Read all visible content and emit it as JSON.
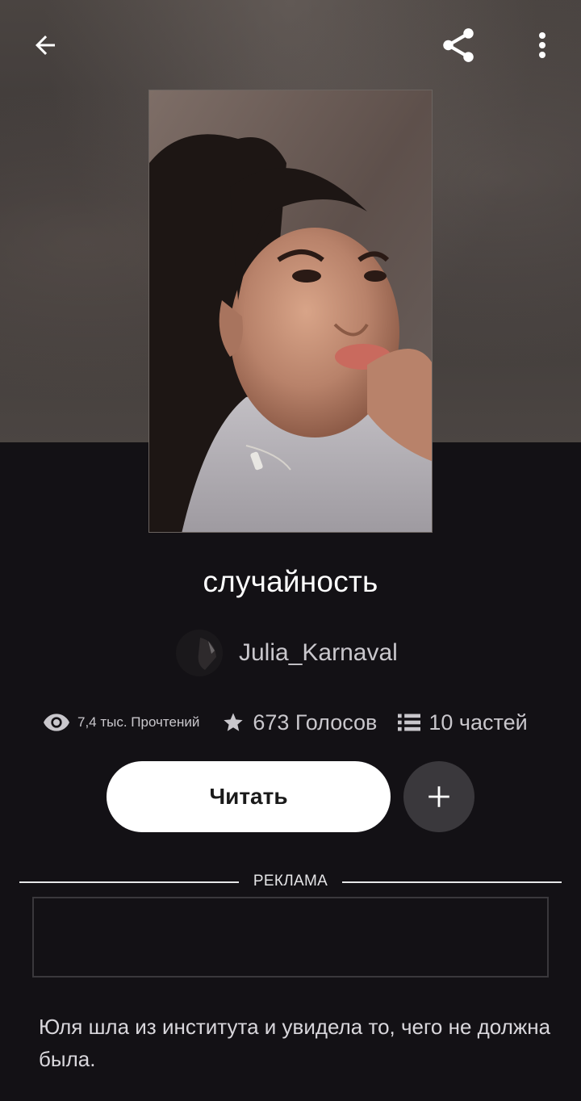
{
  "header": {
    "back_icon": "arrow-left-icon",
    "share_icon": "share-icon",
    "more_icon": "more-vertical-icon"
  },
  "story": {
    "title": "случайность",
    "author": "Julia_Karnaval",
    "description": "Юля шла из института и увидела то, чего не должна была."
  },
  "stats": {
    "reads": "7,4 тыс. Прочтений",
    "votes": "673 Голосов",
    "parts": "10 частей"
  },
  "actions": {
    "read_label": "Читать",
    "add_icon": "plus-icon"
  },
  "ad": {
    "label": "РЕКЛАМА"
  },
  "colors": {
    "background": "#131115",
    "text_secondary": "#c9c7cc",
    "button_primary": "#ffffff",
    "button_secondary": "#3a383c"
  }
}
